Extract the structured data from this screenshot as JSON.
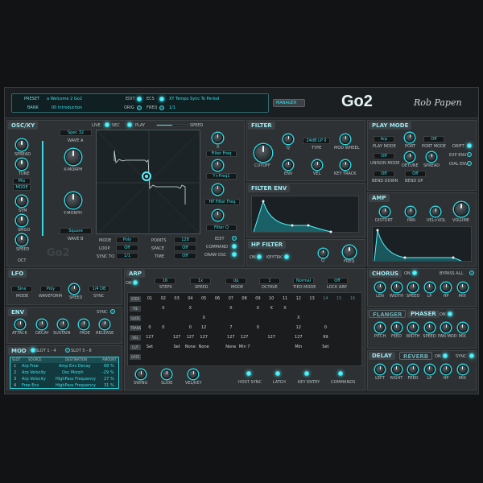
{
  "top": {
    "preset_label": "PRESET",
    "preset_value": "a Welcome 2 Go2",
    "bank_label": "BANK",
    "bank_value": "00 Introduction",
    "edit": "EDIT",
    "orig": "ORIG",
    "ecs": "ECS",
    "freq": "FREQ",
    "xy_text": "XY Tempo Sync To Period",
    "xy_value": "1/1",
    "manager": "MANAGER",
    "logo": "Go2",
    "signature": "Rob Papen"
  },
  "oscxy": {
    "title": "OSC/XY",
    "live": "LIVE",
    "sec": "SEC",
    "play": "PLAY",
    "speed": "SPEED",
    "spread": "SPREAD",
    "tune": "TUNE",
    "wave_a_val": "Spec 32",
    "wave_a": "WAVE A",
    "xmorph": "X-MORPH",
    "ymorph": "Y-MORPH",
    "wave_b_val": "Square",
    "wave_b": "WAVE B",
    "mix": "Mix",
    "mode": "MODE",
    "sym": "SYM",
    "smgo": "SMGO",
    "spread2": "SPEED",
    "oct": "OCT",
    "x_label": "X",
    "x_val": "Filter Freq",
    "y_val": "Y+Freq1",
    "hp_val": "HP Filter Freq",
    "filter_q": "Filter Q",
    "edit": "EDIT",
    "command": "COMMAND",
    "draw": "DRAW OSC",
    "modes": [
      {
        "label": "MODE",
        "val": "Poly"
      },
      {
        "label": "LOOP",
        "val": "Off"
      },
      {
        "label": "SYNC TO",
        "val": "1/1"
      }
    ],
    "points": [
      {
        "label": "POINTS",
        "val": "128"
      },
      {
        "label": "SPACE",
        "val": "Off"
      },
      {
        "label": "TIME",
        "val": "Off"
      }
    ]
  },
  "filter": {
    "title": "FILTER",
    "type_val": "24dB LP II",
    "cutoff": "CUTOFF",
    "q": "Q",
    "type": "TYPE",
    "mod_wheel": "MOD WHEEL",
    "env": "ENV",
    "vel": "VEL",
    "key_track": "KEY TRACK"
  },
  "filter_env": {
    "title": "FILTER ENV"
  },
  "hp_filter": {
    "title": "HP FILTER",
    "on": "ON",
    "keytrk": "KEYTRK",
    "q": "Q",
    "freq": "FREQ"
  },
  "playmode": {
    "title": "PLAY MODE",
    "arp": "Arp",
    "playmode": "PLAY MODE",
    "porta": "PORT",
    "off1": "Off",
    "port_mode": "PORT MODE",
    "unison": "UNISON MODE",
    "detune": "DETUNE",
    "spread": "SPREAD",
    "bend_down": "BEND DOWN",
    "bend_up": "BEND UP",
    "off2": "Off",
    "off3": "Off",
    "off4": "Off",
    "drift": "DRIFT",
    "expenv": "EXP ENV",
    "dialenv": "DIAL ENV"
  },
  "amp": {
    "title": "AMP",
    "distort": "DISTORT",
    "pan": "PAN",
    "velvol": "VEL>VOL",
    "volume": "VOLUME"
  },
  "lfo": {
    "title": "LFO",
    "mode_val": "Sine",
    "wave_val": "Poly",
    "speed_val": "1/4 DB",
    "mode": "MODE",
    "waveform": "WAVEFORM",
    "speed": "SPEED",
    "sync": "SYNC"
  },
  "env": {
    "title": "ENV",
    "sync": "SYNC",
    "attack": "ATTACK",
    "decay": "DECAY",
    "sustain": "SUSTAIN",
    "fade": "FADE",
    "release": "RELEASE"
  },
  "mod": {
    "title": "MOD",
    "slot1": "SLOT 1 - 4",
    "slot2": "SLOT 5 - 8",
    "headers": [
      "SLOT",
      "SOURCE",
      "DESTINATION",
      "AMOUNT"
    ],
    "rows": [
      [
        "1",
        "Arp Free",
        "Amp Env Decay",
        "68 %"
      ],
      [
        "2",
        "Arp Velocity",
        "Osc Morph",
        "-29 %"
      ],
      [
        "3",
        "Arp Velocity",
        "HighPass Frequency",
        "27 %"
      ],
      [
        "4",
        "Free Env",
        "HighPass Frequency",
        "31 %"
      ]
    ]
  },
  "arp": {
    "title": "ARP",
    "on": "ON",
    "steps_val": "16",
    "speed_val": "1x",
    "mode_val": "Up",
    "octave_val": "1",
    "tied_val": "Normal",
    "lock_val": "Off",
    "steps": "STEPS",
    "speed": "SPEED",
    "mode": "MODE",
    "octave": "OCTAVE",
    "tied": "TIED MODE",
    "lock": "LOCK ARP",
    "row_labels": [
      "STEP",
      "TIE",
      "SLIDE",
      "TRANS",
      "VEL",
      "CUT",
      "GATE"
    ],
    "steps_nums": [
      "01",
      "02",
      "03",
      "04",
      "05",
      "06",
      "07",
      "08",
      "09",
      "10",
      "11",
      "12",
      "13",
      "14",
      "15",
      "16"
    ],
    "tie_row": [
      "",
      "X",
      "",
      "X",
      "",
      "",
      "X",
      "",
      "X",
      "X",
      "X",
      "",
      "",
      "",
      "",
      ""
    ],
    "slide_row": [
      "",
      "",
      "",
      "",
      "X",
      "",
      "",
      "",
      "",
      "",
      "",
      "X",
      "",
      "",
      "",
      ""
    ],
    "trans_row": [
      "0",
      "0",
      "",
      "0",
      "12",
      "",
      "7",
      "",
      "0",
      "",
      "",
      "12",
      "",
      "0",
      "",
      ""
    ],
    "vel_row": [
      "127",
      "",
      "127",
      "127",
      "127",
      "",
      "127",
      "127",
      "",
      "127",
      "",
      "127",
      "",
      "99",
      "",
      ""
    ],
    "cut_row": [
      "Set",
      "",
      "Set",
      "None",
      "None",
      "",
      "None",
      "Min 7",
      "",
      "",
      "",
      "Min",
      "",
      "Set",
      "",
      ""
    ],
    "swing": "SWING",
    "slide": "SLIDE",
    "velkey": "VEL/KEY",
    "host_sync": "HOST SYNC",
    "latch": "LATCH",
    "key_entry": "KEY ENTRY",
    "commands": "COMMANDS"
  },
  "chorus": {
    "title": "CHORUS",
    "on": "ON",
    "bypass": "BYPASS ALL",
    "labels": [
      "LEN",
      "WIDTH",
      "SPEED",
      "LP",
      "HP",
      "MIX"
    ]
  },
  "flanger": {
    "title": "FLANGER",
    "phaser": "PHASER",
    "on": "ON",
    "labels": [
      "PITCH",
      "FEED",
      "WIDTH",
      "SPEED",
      "PAN MOD",
      "MIX"
    ]
  },
  "delay": {
    "title": "DELAY",
    "reverb": "REVERB",
    "on": "ON",
    "sync": "SYNC",
    "labels": [
      "LEFT",
      "RIGHT",
      "FEED",
      "LP",
      "HP",
      "MIX"
    ]
  }
}
